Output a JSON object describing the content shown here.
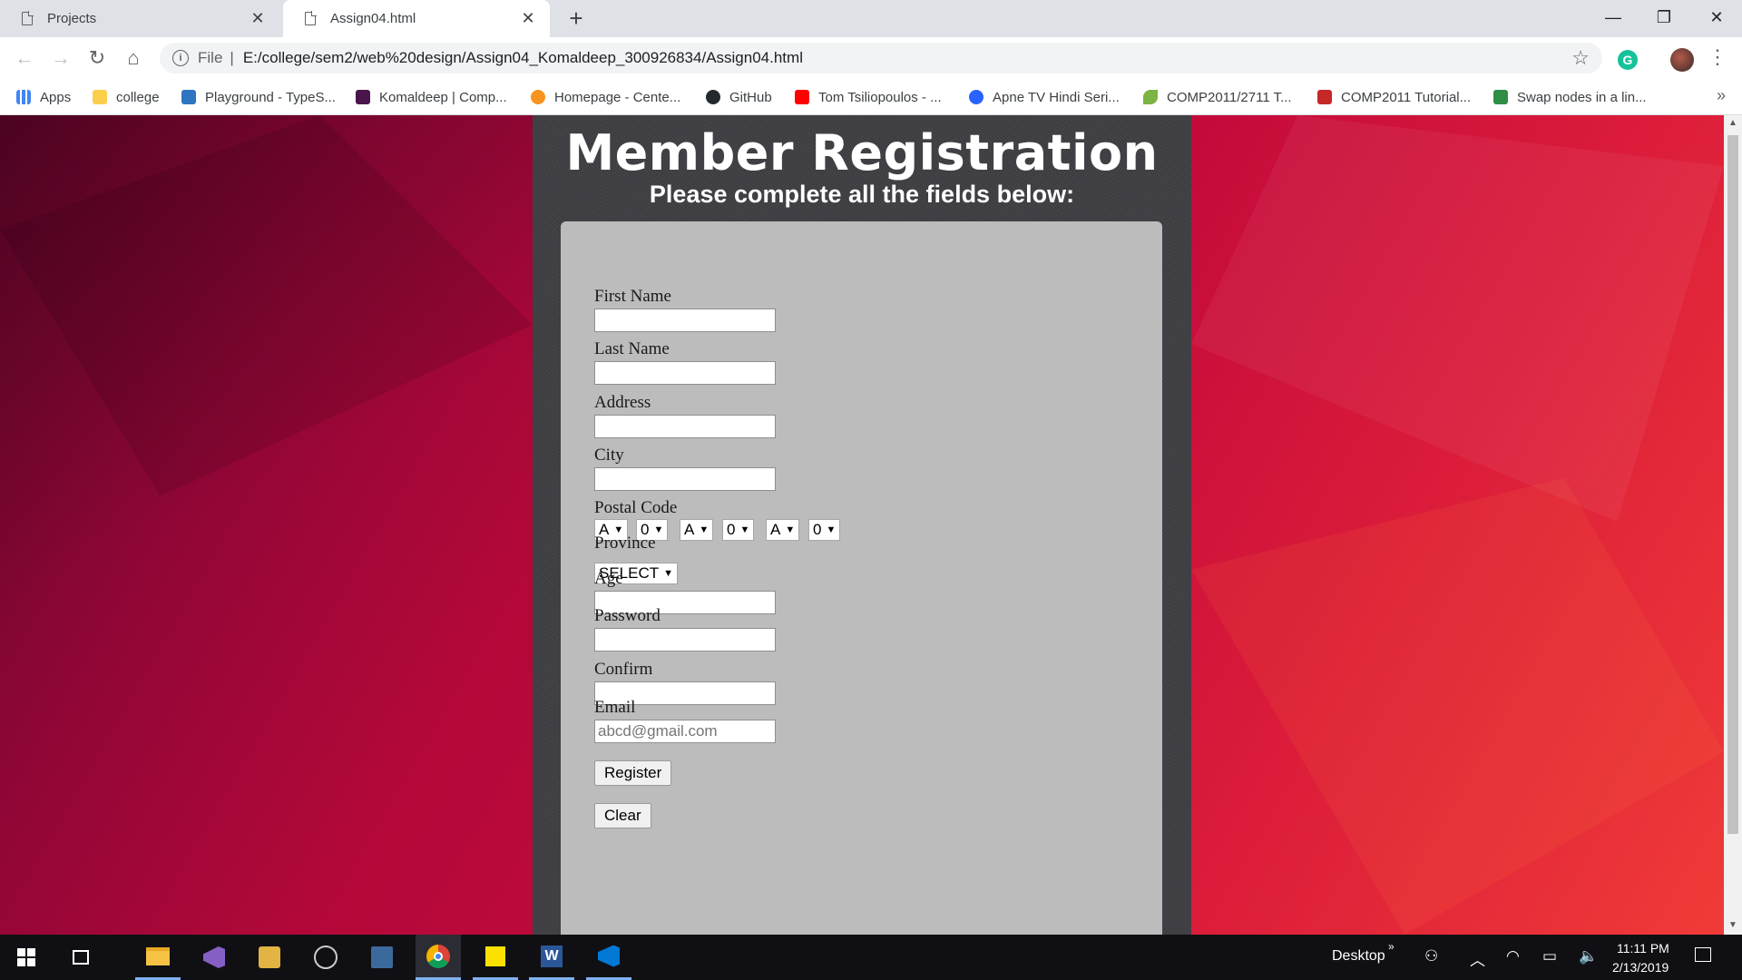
{
  "browser": {
    "tabs": [
      {
        "title": "Projects",
        "active": false
      },
      {
        "title": "Assign04.html",
        "active": true
      }
    ],
    "new_tab": "+",
    "address": {
      "scheme_label": "File",
      "url": "E:/college/sem2/web%20design/Assign04_Komaldeep_300926834/Assign04.html"
    },
    "bookmarks": [
      {
        "label": "Apps",
        "icon": "apps-grid-icon",
        "color": "#4285f4"
      },
      {
        "label": "college",
        "icon": "folder-icon",
        "color": "#fbcf4b"
      },
      {
        "label": "Playground - TypeS...",
        "icon": "typescript-icon",
        "color": "#2f74c0"
      },
      {
        "label": "Komaldeep | Comp...",
        "icon": "slack-icon",
        "color": "#4a154b"
      },
      {
        "label": "Homepage - Cente...",
        "icon": "centennial-icon",
        "color": "#f7931e"
      },
      {
        "label": "GitHub",
        "icon": "github-icon",
        "color": "#24292e"
      },
      {
        "label": "Tom Tsiliopoulos - ...",
        "icon": "youtube-icon",
        "color": "#ff0000"
      },
      {
        "label": "Apne TV Hindi Seri...",
        "icon": "apne-tv-icon",
        "color": "#2962ff"
      },
      {
        "label": "COMP2011/2711 T...",
        "icon": "leaf-icon",
        "color": "#7cb342"
      },
      {
        "label": "COMP2011 Tutorial...",
        "icon": "crest-icon",
        "color": "#c62828"
      },
      {
        "label": "Swap nodes in a lin...",
        "icon": "geeksforgeeks-icon",
        "color": "#2f8d46"
      }
    ],
    "more_bookmarks": "»"
  },
  "page": {
    "title": "Member Registration",
    "subtitle": "Please complete all the fields below:",
    "form": {
      "first_name_label": "First Name",
      "last_name_label": "Last Name",
      "address_label": "Address",
      "city_label": "City",
      "postal_code_label": "Postal Code",
      "postal_selects": [
        "A",
        "0",
        "A",
        "0",
        "A",
        "0"
      ],
      "province_label": "Province",
      "province_value": "SELECT",
      "age_label": "Age",
      "password_label": "Password",
      "confirm_label": "Confirm",
      "email_label": "Email",
      "email_placeholder": "abcd@gmail.com",
      "register_button": "Register",
      "clear_button": "Clear"
    }
  },
  "taskbar": {
    "apps": [
      "windows-start-icon",
      "task-view-icon",
      "file-explorer-icon",
      "visual-studio-icon",
      "db-tool-icon",
      "network-app-icon",
      "terminal-app-icon",
      "chrome-icon",
      "sticky-notes-icon",
      "word-icon",
      "vscode-icon"
    ],
    "desktop_label": "Desktop",
    "chevron": "»",
    "time": "11:11 PM",
    "date": "2/13/2019"
  },
  "colors": {
    "background_dark": "#5c0428",
    "background_light": "#f03b38",
    "column": "#3f3f44",
    "form_panel": "#bcbcbc"
  }
}
